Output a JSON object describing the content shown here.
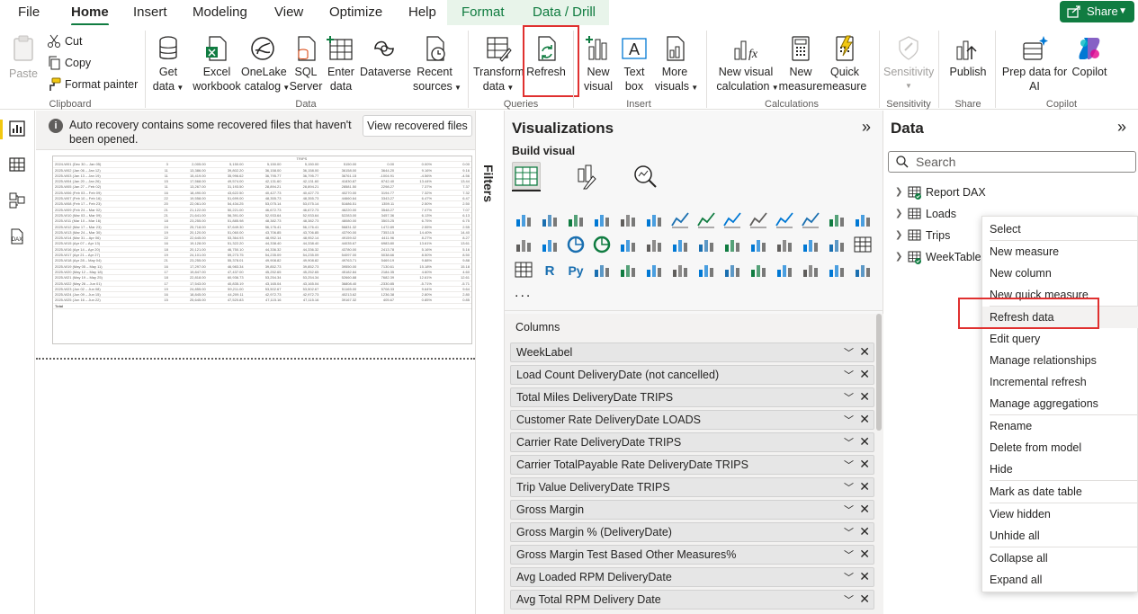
{
  "menubar": {
    "tabs": [
      "File",
      "Home",
      "Insert",
      "Modeling",
      "View",
      "Optimize",
      "Help"
    ],
    "active_tab": "Home",
    "context_tabs": [
      "Format",
      "Data / Drill"
    ],
    "share_label": "Share"
  },
  "ribbon": {
    "clipboard": {
      "paste": "Paste",
      "cut": "Cut",
      "copy": "Copy",
      "format_painter": "Format painter",
      "group": "Clipboard"
    },
    "data": {
      "get_data": [
        "Get",
        "data"
      ],
      "excel": [
        "Excel",
        "workbook"
      ],
      "onelake": [
        "OneLake",
        "catalog"
      ],
      "sql": [
        "SQL",
        "Server"
      ],
      "enter_data": [
        "Enter",
        "data"
      ],
      "dataverse": "Dataverse",
      "recent": [
        "Recent",
        "sources"
      ],
      "group": "Data"
    },
    "queries": {
      "transform": [
        "Transform",
        "data"
      ],
      "refresh": "Refresh",
      "group": "Queries"
    },
    "insert": {
      "new_visual": [
        "New",
        "visual"
      ],
      "text_box": [
        "Text",
        "box"
      ],
      "more_visuals": [
        "More",
        "visuals"
      ],
      "group": "Insert"
    },
    "calculations": {
      "new_visual_calc": [
        "New visual",
        "calculation"
      ],
      "new_measure": [
        "New",
        "measure"
      ],
      "quick_measure": [
        "Quick",
        "measure"
      ],
      "group": "Calculations"
    },
    "sensitivity": {
      "label": "Sensitivity",
      "group": "Sensitivity"
    },
    "share": {
      "publish": "Publish",
      "group": "Share"
    },
    "copilot": {
      "prep": [
        "Prep data for",
        "AI"
      ],
      "copilot": "Copilot",
      "group": "Copilot"
    }
  },
  "banner": {
    "message": "Auto recovery contains some recovered files that haven't been opened.",
    "button": "View recovered files"
  },
  "table_visual": {
    "header": "TRIPS",
    "rows": [
      [
        "2024-W01 (Dec 30 – Jan 05)",
        "3",
        "2,005.00",
        "5,150.00",
        "5,150.00",
        "5,150.00",
        "5150.00",
        "0.00",
        "0.00%",
        "0.00"
      ],
      [
        "2025-W02 (Jan 06 – Jan 12)",
        "11",
        "13,386.00",
        "39,802.20",
        "36,158.00",
        "36,158.00",
        "36158.00",
        "3644.20",
        "9.16%",
        "9.16"
      ],
      [
        "2025-W03 (Jan 13 – Jan 19)",
        "11",
        "15,419.00",
        "35,996.62",
        "36,795.77",
        "36,795.77",
        "36761.15",
        "-1004.91",
        "-4.56%",
        "-4.56"
      ],
      [
        "2025-W04 (Jan 20 – Jan 26)",
        "15",
        "17,568.00",
        "49,574.00",
        "42,131.60",
        "42,131.60",
        "41830.87",
        "8742.40",
        "13.44%",
        "13.44"
      ],
      [
        "2025-W05 (Jan 27 – Feb 02)",
        "11",
        "13,267.00",
        "31,193.50",
        "28,894.21",
        "28,894.21",
        "28581.50",
        "2298.27",
        "7.37%",
        "7.37"
      ],
      [
        "2025-W06 (Feb 03 – Feb 09)",
        "16",
        "18,490.00",
        "43,622.50",
        "40,427.73",
        "40,427.73",
        "40270.00",
        "3194.77",
        "7.32%",
        "7.32"
      ],
      [
        "2025-W07 (Feb 10 – Feb 16)",
        "22",
        "19,558.00",
        "51,699.00",
        "48,355.73",
        "48,355.73",
        "44660.64",
        "3343.27",
        "6.47%",
        "6.47"
      ],
      [
        "2025-W08 (Feb 17 – Feb 23)",
        "20",
        "22,061.00",
        "54,434.25",
        "53,075.14",
        "53,075.14",
        "51686.51",
        "1359.11",
        "2.50%",
        "2.50"
      ],
      [
        "2025-W09 (Feb 24 – Mar 02)",
        "21",
        "21,122.00",
        "50,221.00",
        "46,672.73",
        "46,672.73",
        "46220.00",
        "3548.27",
        "7.07%",
        "7.07"
      ],
      [
        "2025-W10 (Mar 03 – Mar 09)",
        "21",
        "21,641.00",
        "56,391.00",
        "52,933.64",
        "52,933.64",
        "52283.00",
        "3457.36",
        "6.13%",
        "6.13"
      ],
      [
        "2025-W11 (Mar 10 – Mar 16)",
        "18",
        "23,255.00",
        "51,885.98",
        "48,382.73",
        "48,382.73",
        "48080.00",
        "3503.25",
        "6.75%",
        "6.75"
      ],
      [
        "2025-W12 (Mar 17 – Mar 23)",
        "24",
        "25,718.00",
        "57,649.30",
        "56,176.41",
        "56,176.41",
        "56831.32",
        "1472.89",
        "2.55%",
        "2.55"
      ],
      [
        "2025-W13 (Mar 24 – Mar 30)",
        "19",
        "20,120.00",
        "51,060.00",
        "43,706.85",
        "43,706.85",
        "43790.00",
        "7353.15",
        "14.40%",
        "14.40"
      ],
      [
        "2025-W14 (Mar 31 – Apr 06)",
        "22",
        "22,645.00",
        "53,364.93",
        "48,952.14",
        "48,952.14",
        "49159.02",
        "4411.96",
        "8.27%",
        "8.27"
      ],
      [
        "2025-W15 (Apr 07 – Apr 13)",
        "16",
        "19,128.00",
        "51,322.20",
        "44,338.40",
        "44,338.40",
        "44035.67",
        "6983.80",
        "13.61%",
        "13.61"
      ],
      [
        "2025-W16 (Apr 14 – Apr 20)",
        "18",
        "20,121.00",
        "46,750.10",
        "44,336.32",
        "44,336.32",
        "43780.00",
        "2413.78",
        "5.16%",
        "5.16"
      ],
      [
        "2025-W17 (Apr 21 – Apr 27)",
        "19",
        "24,101.00",
        "59,273.75",
        "54,235.09",
        "54,235.09",
        "54097.00",
        "5038.66",
        "8.50%",
        "8.50"
      ],
      [
        "2025-W18 (Apr 28 – May 04)",
        "21",
        "23,255.00",
        "55,378.01",
        "49,908.82",
        "49,908.82",
        "49763.71",
        "5469.19",
        "9.88%",
        "9.88"
      ],
      [
        "2025-W19 (May 05 – May 11)",
        "16",
        "17,297.00",
        "46,983.34",
        "39,852.73",
        "39,852.73",
        "39550.00",
        "7130.61",
        "15.18%",
        "15.18"
      ],
      [
        "2025-W20 (May 12 – May 18)",
        "17",
        "19,847.00",
        "47,437.00",
        "45,252.65",
        "45,252.65",
        "45182.84",
        "2184.35",
        "4.60%",
        "4.60"
      ],
      [
        "2025-W21 (May 19 – May 25)",
        "18",
        "22,818.00",
        "60,936.73",
        "53,254.34",
        "53,254.34",
        "52660.88",
        "7682.39",
        "12.61%",
        "12.61"
      ],
      [
        "2025-W22 (May 26 – Jun 01)",
        "17",
        "17,543.00",
        "40,835.19",
        "43,165.04",
        "43,165.04",
        "36808.40",
        "-2330.85",
        "-5.71%",
        "-5.71"
      ],
      [
        "2025-W23 (Jun 02 – Jun 08)",
        "19",
        "24,855.00",
        "59,211.00",
        "53,502.67",
        "53,502.67",
        "51165.00",
        "5708.33",
        "9.64%",
        "9.64"
      ],
      [
        "2025-W24 (Jun 09 – Jun 15)",
        "16",
        "18,845.00",
        "44,209.11",
        "42,972.73",
        "42,972.73",
        "40213.62",
        "1236.38",
        "2.80%",
        "2.80"
      ],
      [
        "2025-W25 (Jun 16 – Jun 22)",
        "15",
        "25,645.00",
        "47,520.83",
        "47,115.16",
        "47,115.16",
        "39167.32",
        "405.67",
        "0.85%",
        "0.85"
      ],
      [
        "Total",
        "",
        "",
        "",
        "",
        "",
        "",
        "",
        "",
        ""
      ]
    ]
  },
  "filters": {
    "label": "Filters"
  },
  "visualizations": {
    "title": "Visualizations",
    "build_visual": "Build visual",
    "more": "...",
    "well_label": "Columns",
    "fields": [
      "WeekLabel",
      "Load Count DeliveryDate (not cancelled)",
      "Total Miles DeliveryDate TRIPS",
      "Customer Rate DeliveryDate LOADS",
      "Carrier Rate DeliveryDate TRIPS",
      "Carrier TotalPayable Rate DeliveryDate TRIPS",
      "Trip Value DeliveryDate TRIPS",
      "Gross Margin",
      "Gross Margin % (DeliveryDate)",
      "Gross Margin Test Based Other Measures%",
      "Avg Loaded RPM DeliveryDate",
      "Avg Total RPM Delivery Date"
    ]
  },
  "data_pane": {
    "title": "Data",
    "search_placeholder": "Search",
    "tables": [
      "Report DAX",
      "Loads",
      "Trips",
      "WeekTable"
    ]
  },
  "context_menu": {
    "items": [
      "Select",
      "New measure",
      "New column",
      "New quick measure",
      "Refresh data",
      "Edit query",
      "Manage relationships",
      "Incremental refresh",
      "Manage aggregations",
      "Rename",
      "Delete from model",
      "Hide",
      "Mark as date table",
      "View hidden",
      "Unhide all",
      "Collapse all",
      "Expand all"
    ],
    "highlighted": "Refresh data"
  },
  "colors": {
    "accent_green": "#107c41",
    "highlight_red": "#e0302f",
    "report_active": "#f2c811"
  }
}
